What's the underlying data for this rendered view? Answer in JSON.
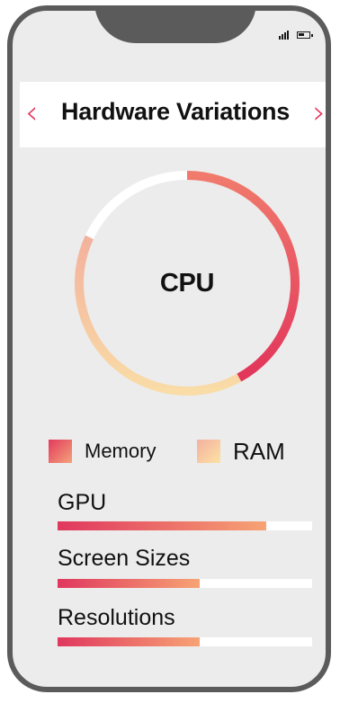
{
  "header": {
    "title": "Hardware Variations",
    "prev_icon": "chevron-left-icon",
    "next_icon": "chevron-right-icon"
  },
  "status_bar": {
    "signal_icon": "signal-icon",
    "battery_icon": "battery-icon"
  },
  "donut": {
    "center_label": "CPU",
    "segments": [
      {
        "name": "Memory",
        "fraction": 0.42,
        "color_from": "#e3325a",
        "color_to": "#f27f6a"
      },
      {
        "name": "RAM",
        "fraction": 0.4,
        "color_from": "#f5b29a",
        "color_to": "#f9dda7"
      },
      {
        "name": "remaining",
        "fraction": 0.18,
        "color": "#ffffff"
      }
    ]
  },
  "legend": [
    {
      "label": "Memory"
    },
    {
      "label": "RAM"
    }
  ],
  "bars": [
    {
      "label": "GPU",
      "value": 0.82
    },
    {
      "label": "Screen Sizes",
      "value": 0.56
    },
    {
      "label": "Resolutions",
      "value": 0.56
    }
  ],
  "colors": {
    "accent": "#e3325a",
    "frame": "#5b5b5b",
    "screen": "#ececec"
  }
}
